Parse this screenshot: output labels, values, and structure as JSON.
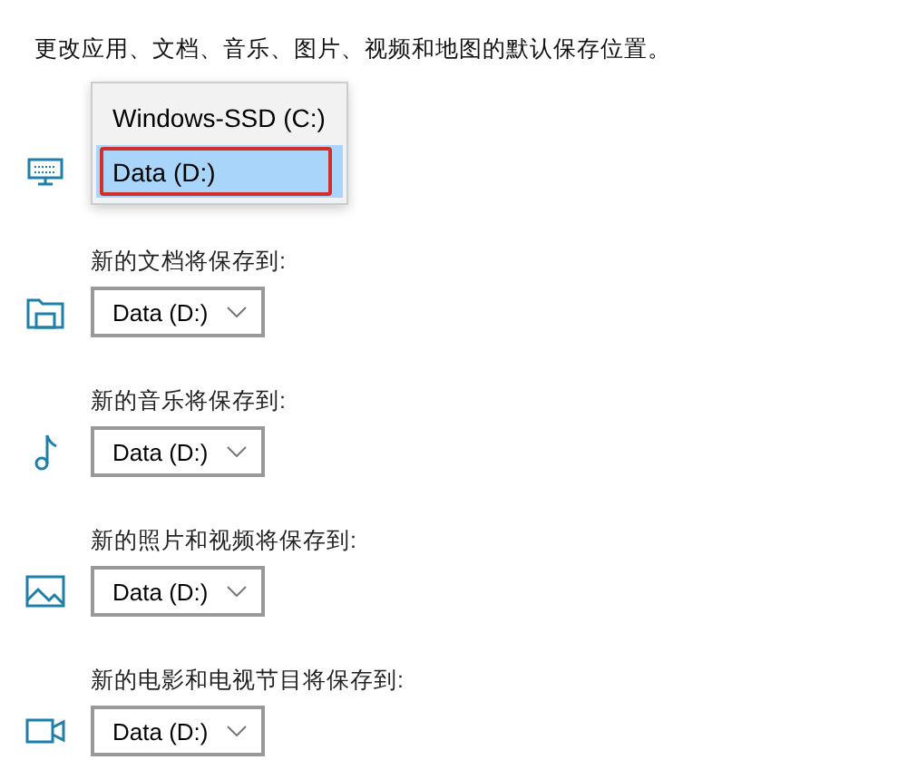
{
  "description": "更改应用、文档、音乐、图片、视频和地图的默认保存位置。",
  "rows": [
    {
      "kind": "menu",
      "options": [
        {
          "label": "Windows-SSD (C:)",
          "selected": false,
          "annotated": false
        },
        {
          "label": "Data (D:)",
          "selected": true,
          "annotated": true
        }
      ]
    },
    {
      "kind": "dropdown",
      "label": "新的文档将保存到:",
      "value": "Data (D:)"
    },
    {
      "kind": "dropdown",
      "label": "新的音乐将保存到:",
      "value": "Data (D:)"
    },
    {
      "kind": "dropdown",
      "label": "新的照片和视频将保存到:",
      "value": "Data (D:)"
    },
    {
      "kind": "dropdown",
      "label": "新的电影和电视节目将保存到:",
      "value": "Data (D:)"
    }
  ]
}
